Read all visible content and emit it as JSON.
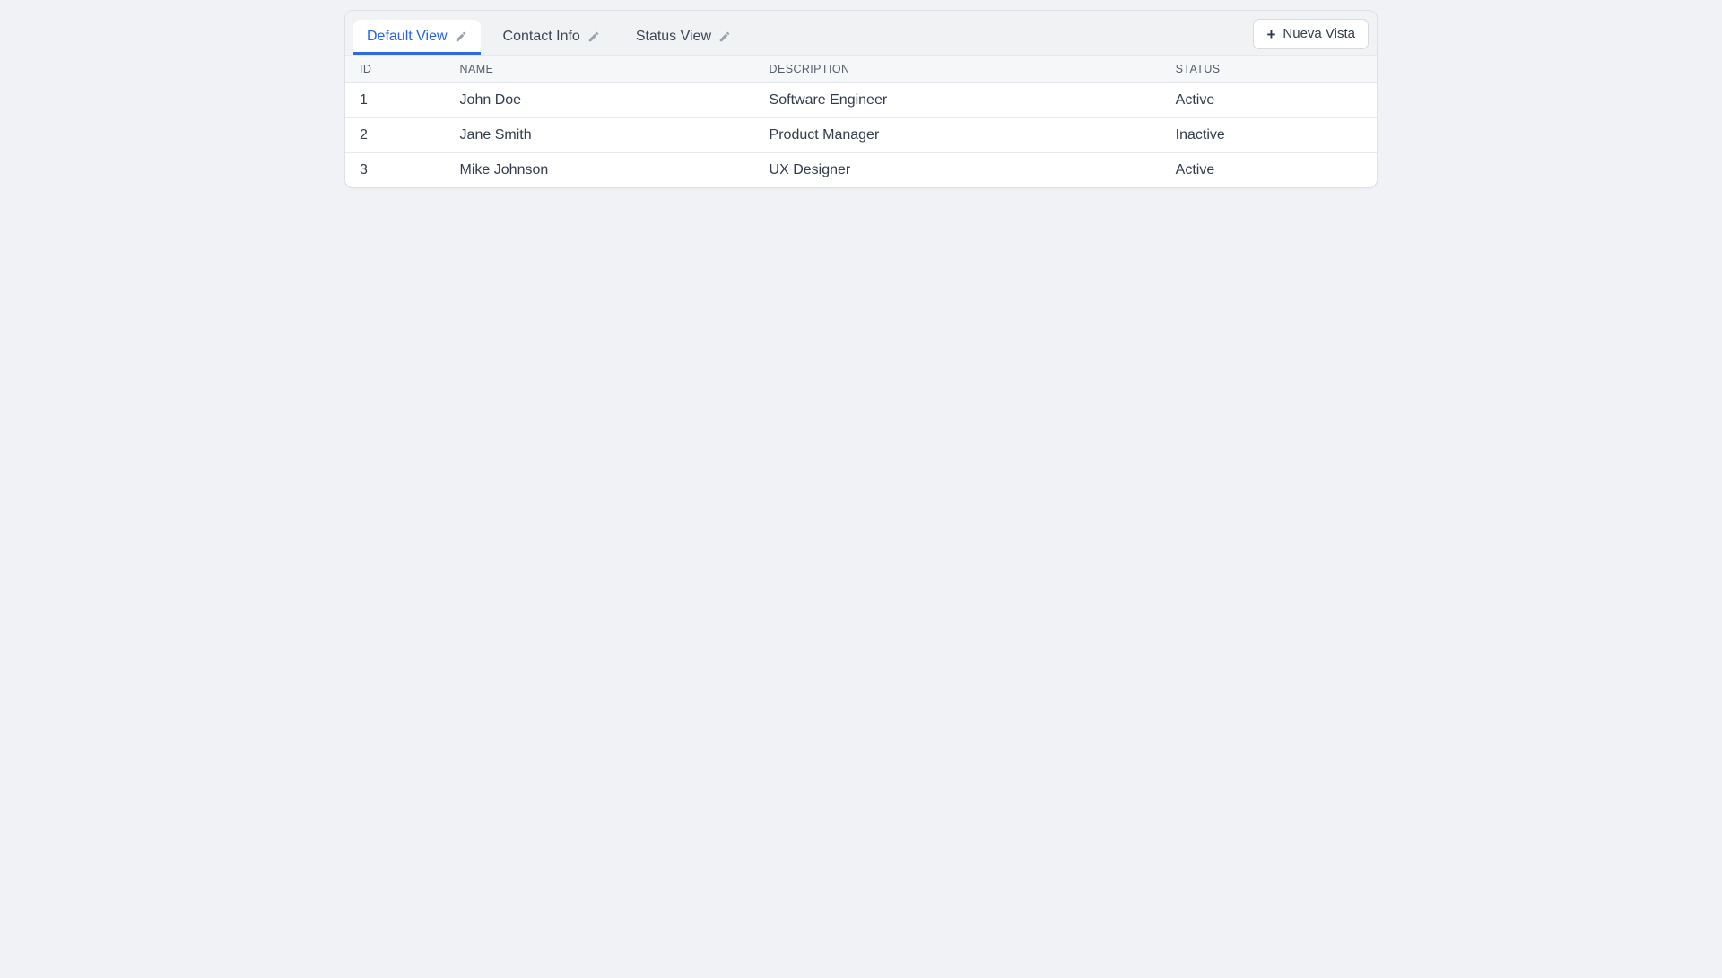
{
  "tabs": [
    {
      "label": "Default View",
      "active": true
    },
    {
      "label": "Contact Info",
      "active": false
    },
    {
      "label": "Status View",
      "active": false
    }
  ],
  "new_view_button": {
    "plus_glyph": "+",
    "label": "Nueva Vista"
  },
  "table": {
    "columns": [
      "ID",
      "NAME",
      "DESCRIPTION",
      "STATUS"
    ],
    "rows": [
      {
        "id": "1",
        "name": "John Doe",
        "description": "Software Engineer",
        "status": "Active"
      },
      {
        "id": "2",
        "name": "Jane Smith",
        "description": "Product Manager",
        "status": "Inactive"
      },
      {
        "id": "3",
        "name": "Mike Johnson",
        "description": "UX Designer",
        "status": "Active"
      }
    ]
  },
  "colors": {
    "page_background": "#f0f2f5",
    "tabbar_background": "#f1f2f4",
    "active_tab_text": "#2563eb",
    "active_tab_underline": "#2f6be0",
    "header_background": "#f6f7f9",
    "border": "#dde0e5"
  }
}
